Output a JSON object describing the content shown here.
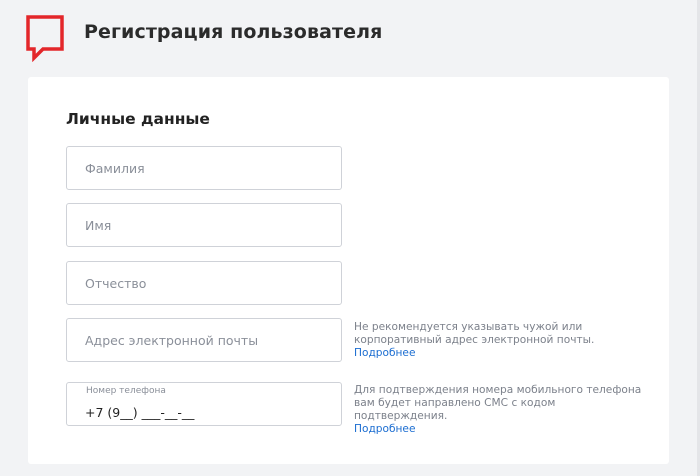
{
  "header": {
    "title": "Регистрация пользователя",
    "logo_icon": "speech-bubble-logo-icon",
    "logo_color": "#e3262a"
  },
  "form": {
    "section_title": "Личные данные",
    "last_name": {
      "placeholder": "Фамилия",
      "value": ""
    },
    "first_name": {
      "placeholder": "Имя",
      "value": ""
    },
    "middle_name": {
      "placeholder": "Отчество",
      "value": ""
    },
    "email": {
      "placeholder": "Адрес электронной почты",
      "value": "",
      "hint": "Не рекомендуется указывать чужой или корпоративный адрес электронной почты.",
      "hint_link": "Подробнее"
    },
    "phone": {
      "label": "Номер телефона",
      "value": "+7 (9__) ___-__-__",
      "hint": "Для подтверждения номера мобильного телефона вам будет направлено СМС с кодом подтверждения.",
      "hint_link": "Подробнее"
    }
  },
  "colors": {
    "background": "#f2f3f5",
    "card": "#ffffff",
    "link": "#1b6dd1",
    "accent": "#e3262a"
  }
}
